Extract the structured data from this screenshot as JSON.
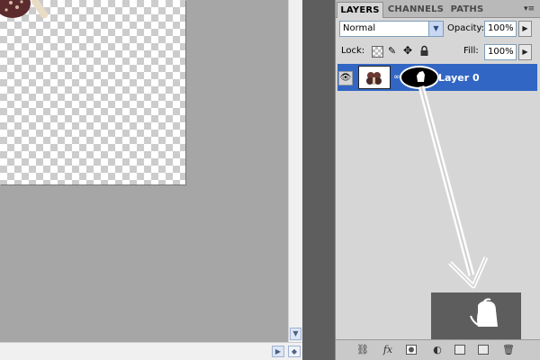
{
  "panel": {
    "tabs": [
      {
        "label": "LAYERS",
        "active": true
      },
      {
        "label": "CHANNELS",
        "active": false
      },
      {
        "label": "PATHS",
        "active": false
      }
    ],
    "menu_icon": "panel-menu-icon",
    "blend_mode": "Normal",
    "opacity_label": "Opacity:",
    "opacity_value": "100%",
    "lock_label": "Lock:",
    "fill_label": "Fill:",
    "fill_value": "100%",
    "lock_icons": [
      "lock-transparent-icon",
      "lock-image-icon",
      "lock-position-icon",
      "lock-all-icon"
    ]
  },
  "layers": [
    {
      "name": "Layer 0",
      "selected": true,
      "visible": true,
      "has_mask": true
    }
  ],
  "bottom_icons": [
    "link-icon",
    "fx-icon",
    "mask-icon",
    "adjustment-icon",
    "group-icon",
    "new-layer-icon",
    "trash-icon"
  ],
  "fx_label": "fx",
  "colors": {
    "selection": "#3166c4",
    "panel_bg": "#d6d6d6",
    "canvas_bg": "#a6a6a6",
    "divider": "#5e5e5e"
  }
}
